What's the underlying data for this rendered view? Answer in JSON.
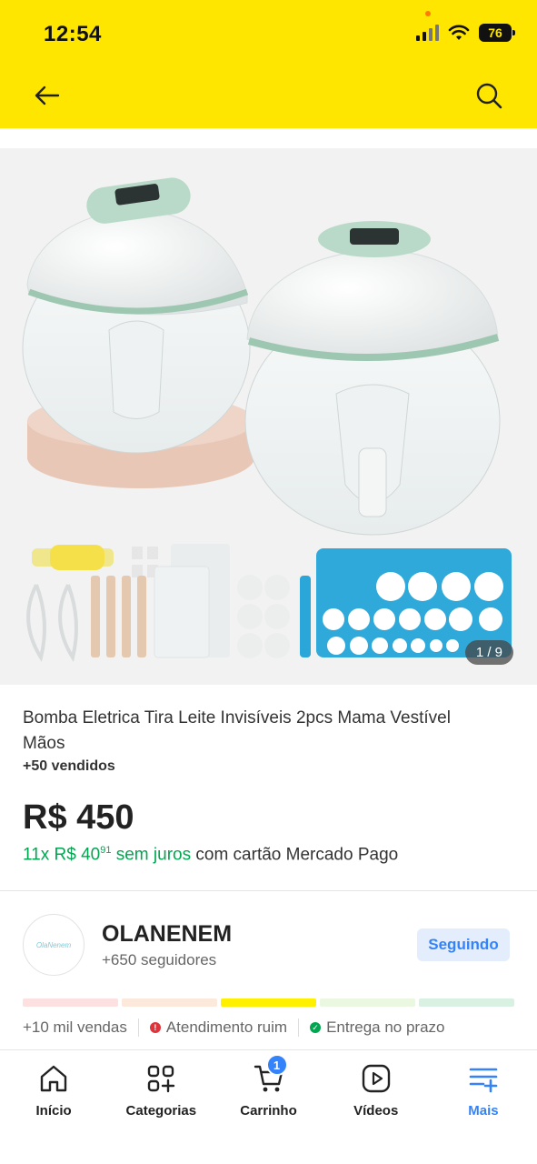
{
  "status_bar": {
    "time": "12:54",
    "battery": "76"
  },
  "header": {
    "background": "#ffe600"
  },
  "gallery": {
    "page_indicator": "1 / 9"
  },
  "product": {
    "title": "Bomba Eletrica Tira Leite Invisíveis 2pcs Mama Vestível Mãos",
    "sold": "+50 vendidos",
    "price": "R$ 450",
    "installments_prefix": "11x R$ 40",
    "installments_cents": "91",
    "installments_green_suffix": " sem juros",
    "installments_suffix": " com cartão Mercado Pago"
  },
  "seller": {
    "avatar_text": "OlaNenem",
    "name": "OLANENEM",
    "followers": "+650 seguidores",
    "follow_label": "Seguindo",
    "reputation_colors": [
      "#fde1e1",
      "#fde8dc",
      "#fff000",
      "#eaf8e2",
      "#d9f1e3"
    ],
    "sales": "+10 mil vendas",
    "service": "Atendimento ruim",
    "delivery": "Entrega no prazo"
  },
  "bottom_nav": {
    "items": [
      {
        "label": "Início",
        "icon": "home-icon"
      },
      {
        "label": "Categorias",
        "icon": "categories-icon"
      },
      {
        "label": "Carrinho",
        "icon": "cart-icon",
        "badge": "1"
      },
      {
        "label": "Vídeos",
        "icon": "play-icon"
      },
      {
        "label": "Mais",
        "icon": "menu-plus-icon"
      }
    ],
    "active_color": "#3483fa"
  }
}
